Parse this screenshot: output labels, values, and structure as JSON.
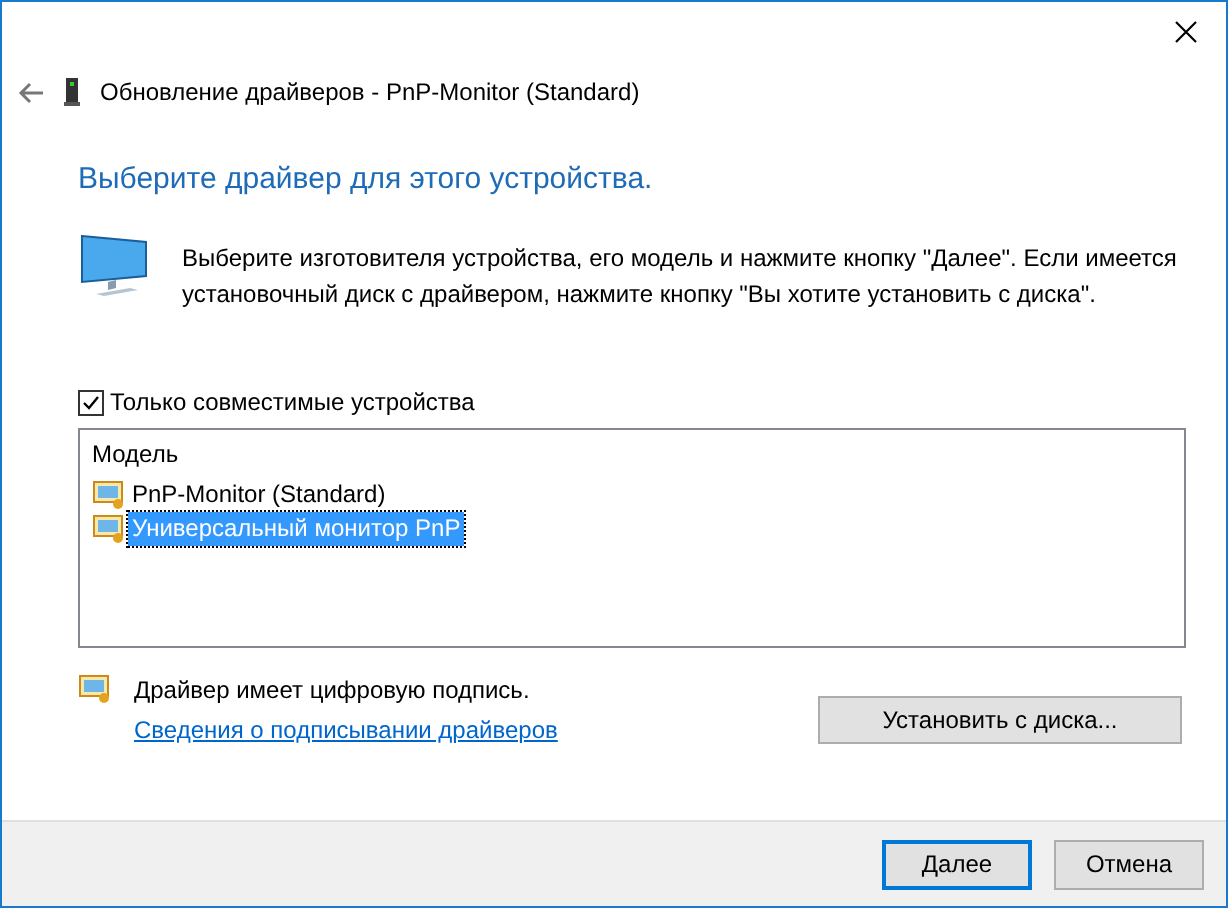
{
  "window": {
    "title": "Обновление драйверов - PnP-Monitor (Standard)"
  },
  "heading": "Выберите драйвер для этого устройства.",
  "description": "Выберите изготовителя устройства, его модель и нажмите кнопку \"Далее\". Если имеется установочный диск с  драйвером, нажмите кнопку \"Вы хотите установить с диска\".",
  "compatible_only": {
    "label": "Только совместимые устройства",
    "checked": true
  },
  "model_list": {
    "header": "Модель",
    "items": [
      {
        "label": "PnP-Monitor (Standard)",
        "selected": false
      },
      {
        "label": "Универсальный монитор PnP",
        "selected": true
      }
    ]
  },
  "signature": {
    "text": "Драйвер имеет цифровую подпись.",
    "link": "Сведения о подписывании драйверов"
  },
  "have_disk_button": "Установить с диска...",
  "buttons": [
    {
      "label": "Далее",
      "default": true
    },
    {
      "label": "Отмена",
      "default": false
    }
  ]
}
